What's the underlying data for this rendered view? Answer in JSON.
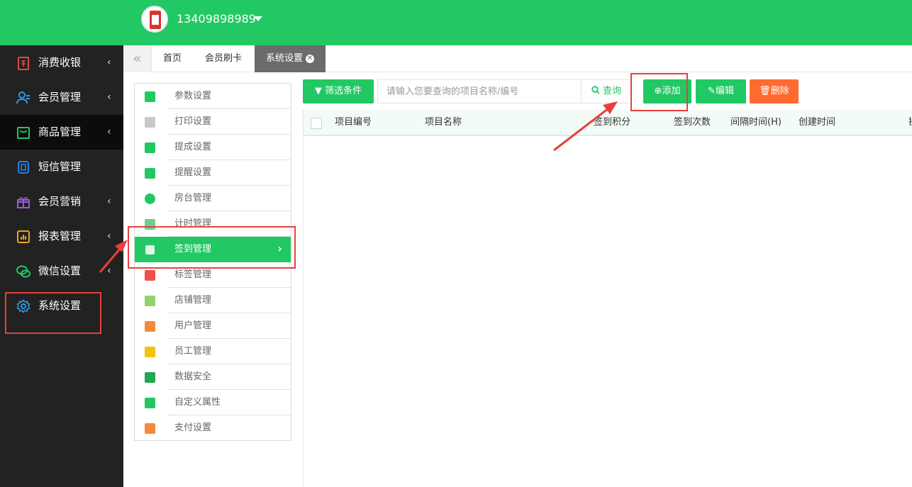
{
  "header": {
    "username": "13409898989",
    "bg_color": "#22c863"
  },
  "sidebar": {
    "items": [
      {
        "label": "消费收银",
        "icon": "cashier-icon",
        "arrow": "‹"
      },
      {
        "label": "会员管理",
        "icon": "members-icon",
        "arrow": "‹"
      },
      {
        "label": "商品管理",
        "icon": "goods-icon",
        "arrow": "‹"
      },
      {
        "label": "短信管理",
        "icon": "sms-icon",
        "arrow": ""
      },
      {
        "label": "会员营销",
        "icon": "gift-icon",
        "arrow": "‹"
      },
      {
        "label": "报表管理",
        "icon": "report-icon",
        "arrow": "‹"
      },
      {
        "label": "微信设置",
        "icon": "wechat-icon",
        "arrow": "‹"
      },
      {
        "label": "系统设置",
        "icon": "settings-gear-icon",
        "arrow": ""
      }
    ]
  },
  "tabs": {
    "collapse": "«",
    "items": [
      {
        "label": "首页"
      },
      {
        "label": "会员刷卡"
      },
      {
        "label": "系统设置",
        "close": "✕"
      }
    ]
  },
  "settings_list": {
    "items": [
      {
        "label": "参数设置",
        "icon": "params-icon",
        "color": "#22c863"
      },
      {
        "label": "打印设置",
        "icon": "printer-icon",
        "color": "#c8c8c8"
      },
      {
        "label": "提成设置",
        "icon": "commission-icon",
        "color": "#22c863"
      },
      {
        "label": "提醒设置",
        "icon": "bell-icon",
        "color": "#22c863"
      },
      {
        "label": "房台管理",
        "icon": "room-icon",
        "color": "#22c863"
      },
      {
        "label": "计时管理",
        "icon": "timer-icon",
        "color": "#6bd08c"
      },
      {
        "label": "签到管理",
        "icon": "checkin-icon",
        "color": "#ffffff"
      },
      {
        "label": "标签管理",
        "icon": "tag-icon",
        "color": "#f0504a"
      },
      {
        "label": "店铺管理",
        "icon": "shop-icon",
        "color": "#8fd36a"
      },
      {
        "label": "用户管理",
        "icon": "user-icon",
        "color": "#f5893a"
      },
      {
        "label": "员工管理",
        "icon": "staff-icon",
        "color": "#f4c20d"
      },
      {
        "label": "数据安全",
        "icon": "data-chart-icon",
        "color": "#22a84f"
      },
      {
        "label": "自定义属性",
        "icon": "pencil-icon",
        "color": "#22c863"
      },
      {
        "label": "支付设置",
        "icon": "payment-icon",
        "color": "#f5893a"
      }
    ],
    "active_chevron": "›"
  },
  "toolbar": {
    "filter_label": "筛选条件",
    "search_placeholder": "请输入您要查询的项目名称/编号",
    "search_value": "",
    "query_label": "查询",
    "add_label": "添加",
    "edit_label": "编辑",
    "delete_label": "删除",
    "delete_color": "#ff6a2f"
  },
  "table": {
    "columns": [
      "项目编号",
      "项目名称",
      "签到积分",
      "签到次数",
      "间隔时间(H)",
      "创建时间",
      "操"
    ]
  },
  "annotation_color": "#e7413a"
}
